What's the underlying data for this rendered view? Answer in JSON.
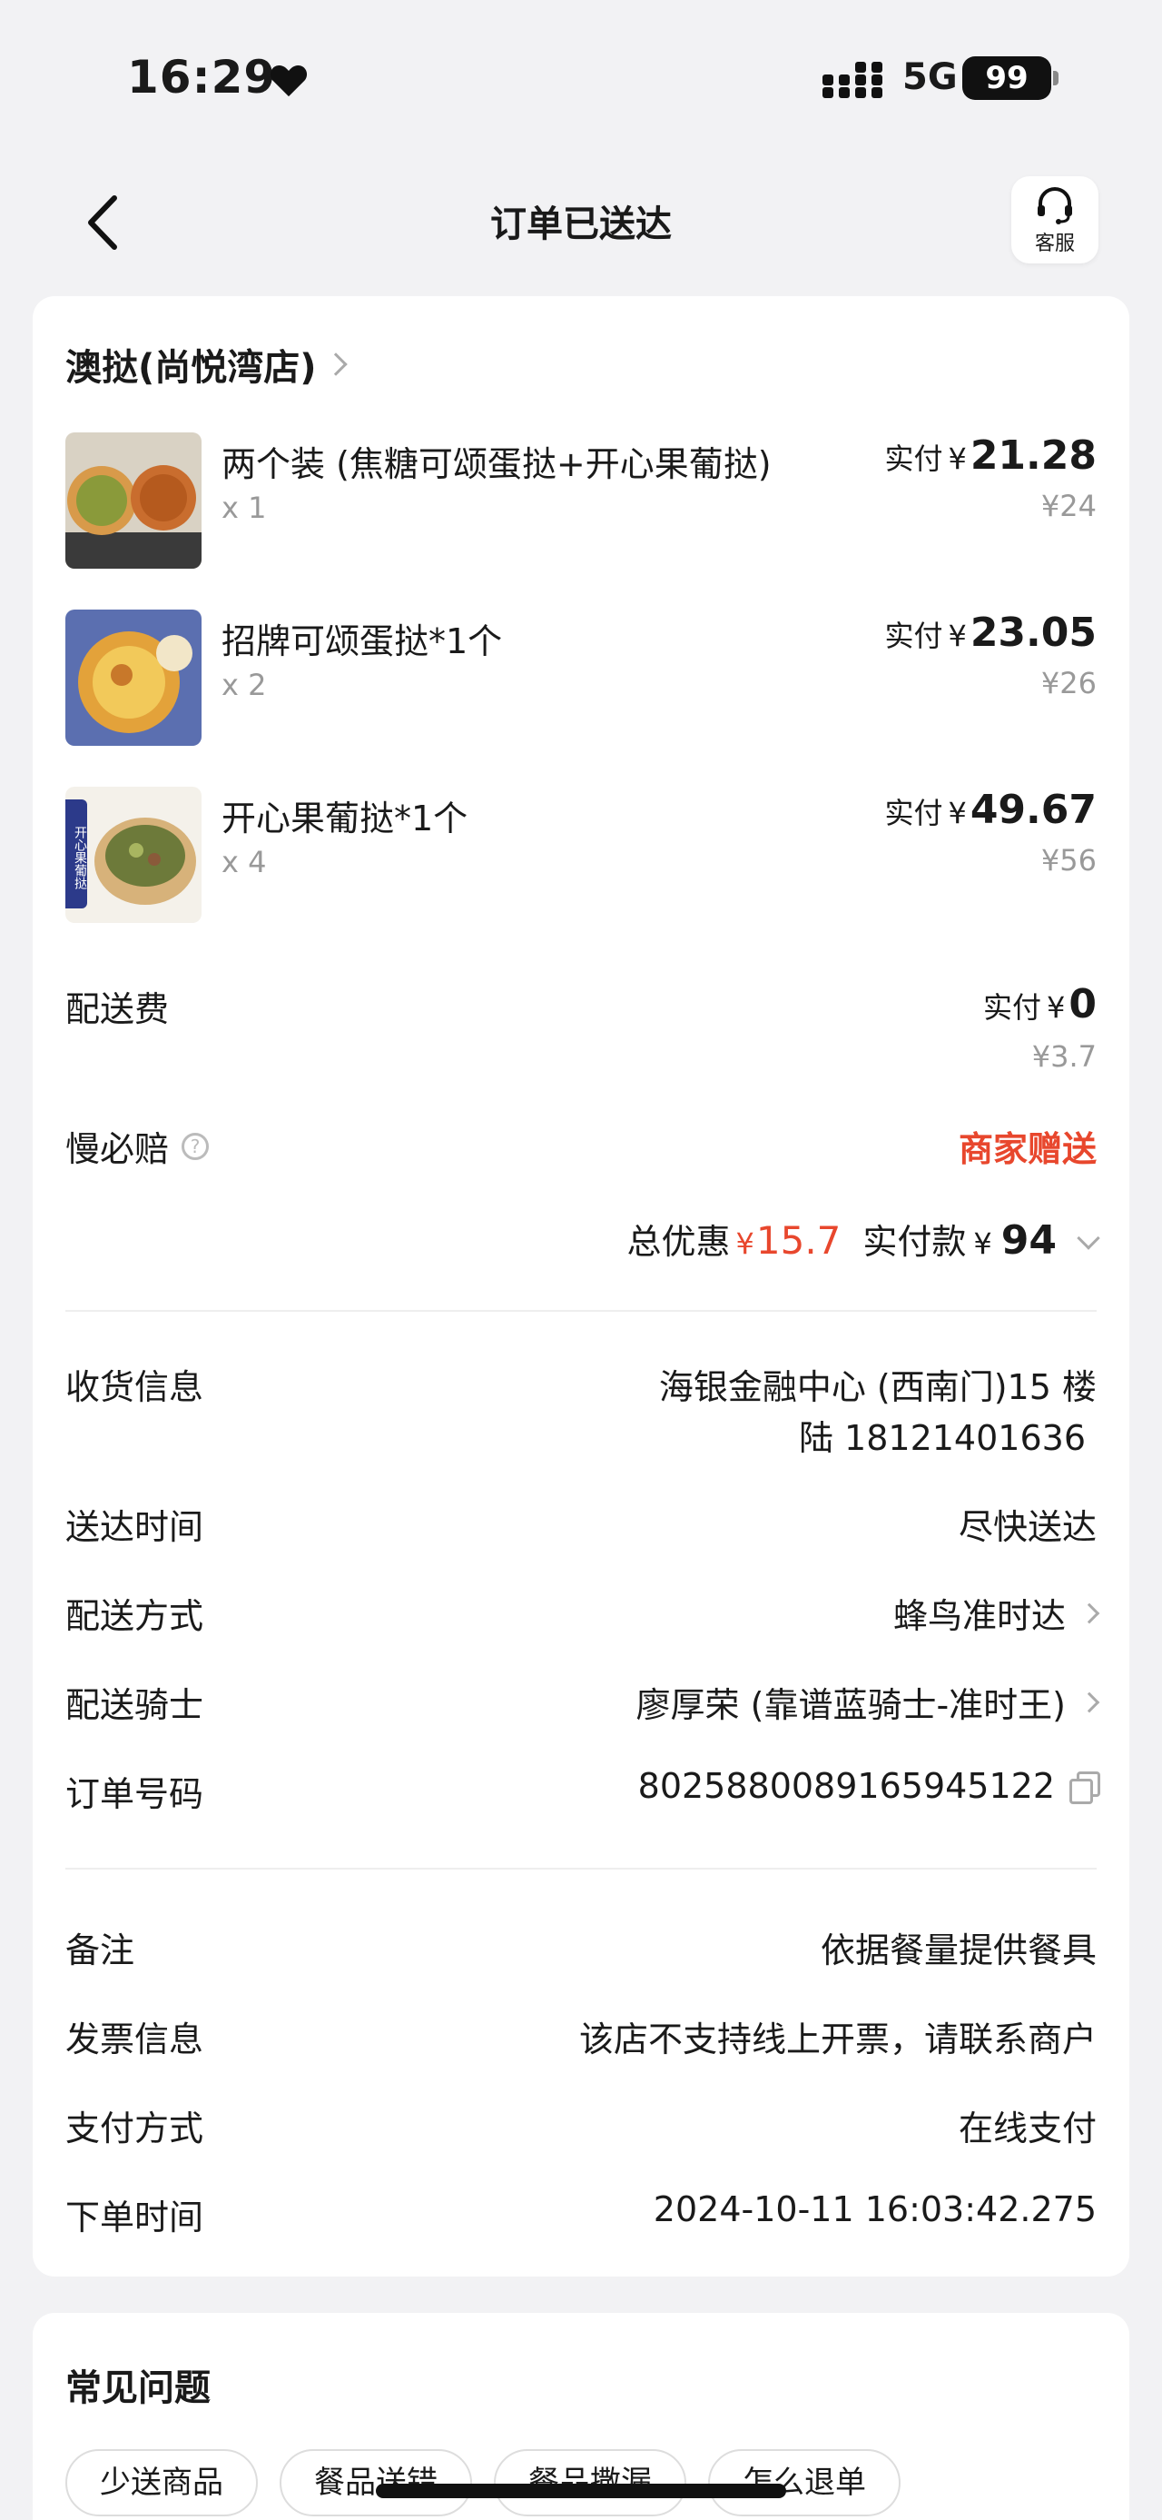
{
  "status_bar": {
    "time": "16:29",
    "network": "5G",
    "battery": "99"
  },
  "nav": {
    "title": "订单已送达",
    "service_label": "客服"
  },
  "store": {
    "name": "澳挞(尚悦湾店)"
  },
  "items": [
    {
      "name": "两个装 (焦糖可颂蛋挞+开心果葡挞)",
      "qty": "x 1",
      "paid_label": "实付",
      "yen": "¥",
      "paid": "21.28",
      "original": "¥24"
    },
    {
      "name": "招牌可颂蛋挞*1个",
      "qty": "x 2",
      "paid_label": "实付",
      "yen": "¥",
      "paid": "23.05",
      "original": "¥26"
    },
    {
      "name": "开心果葡挞*1个",
      "qty": "x 4",
      "paid_label": "实付",
      "yen": "¥",
      "paid": "49.67",
      "original": "¥56"
    }
  ],
  "thumb_badge": "开心果葡挞",
  "delivery_fee": {
    "label": "配送费",
    "paid_label": "实付",
    "yen": "¥",
    "paid": "0",
    "original": "¥3.7"
  },
  "slow_compensation": {
    "label": "慢必赔",
    "help": "?",
    "value": "商家赠送"
  },
  "totals": {
    "discount_label": "总优惠",
    "discount_yen": "¥",
    "discount": "15.7",
    "paid_label": "实付款",
    "paid_yen": "¥",
    "paid": "94"
  },
  "info": {
    "receiver_label": "收货信息",
    "receiver_address": "海银金融中心 (西南门)15 楼",
    "receiver_contact": "陆 18121401636",
    "delivery_time_label": "送达时间",
    "delivery_time": "尽快送达",
    "delivery_method_label": "配送方式",
    "delivery_method": "蜂鸟准时达",
    "rider_label": "配送骑士",
    "rider": "廖厚荣 (靠谱蓝骑士-准时王)",
    "order_no_label": "订单号码",
    "order_no": "8025880089165945122",
    "remark_label": "备注",
    "remark": "依据餐量提供餐具",
    "invoice_label": "发票信息",
    "invoice": "该店不支持线上开票，请联系商户",
    "payment_label": "支付方式",
    "payment": "在线支付",
    "order_time_label": "下单时间",
    "order_time": "2024-10-11 16:03:42.275"
  },
  "faq": {
    "title": "常见问题",
    "chips": [
      "少送商品",
      "餐品送错",
      "餐品撒漏",
      "怎么退单"
    ]
  },
  "colors": {
    "accent_red": "#e8472d",
    "background": "#f2f2f4"
  }
}
